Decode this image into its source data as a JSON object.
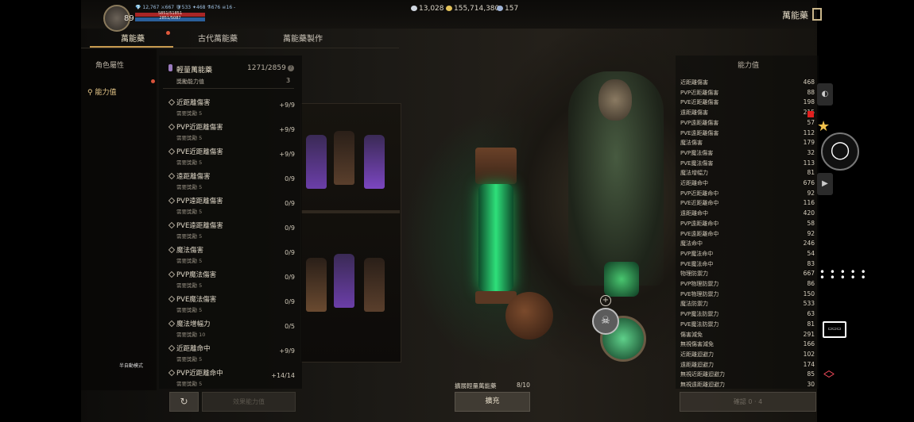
{
  "topbar": {
    "level": "89",
    "stats": "💎 12,767  ⚔667  🛡533  ✦468  ⚗676  ☠16 -",
    "hp_text": "5851/51851",
    "mp_text": "2851/5087",
    "currencies": [
      {
        "name": "diamond",
        "value": "13,028",
        "color": "#cfd6e0"
      },
      {
        "name": "gold",
        "value": "155,714,380",
        "color": "#e3c25a"
      },
      {
        "name": "carriage",
        "value": "157",
        "color": "#9fb4d6"
      }
    ],
    "page_title": "萬能藥"
  },
  "tabs": [
    {
      "label": "萬能藥",
      "active": true
    },
    {
      "label": "古代萬能藥",
      "active": false
    },
    {
      "label": "萬能藥製作",
      "active": false
    }
  ],
  "left_nav": {
    "items": [
      {
        "label": "角色屬性",
        "active": false
      },
      {
        "label": "能力值",
        "active": true
      }
    ],
    "auto_mode": "半自動模式"
  },
  "potion": {
    "name": "輕量萬能藥",
    "count": "1271/2859",
    "reward_label": "獎勵能力值",
    "reward_value": "3"
  },
  "upgrade_rows": [
    {
      "name": "近距離傷害",
      "req": "需要獎勵 5",
      "value": "+9/9"
    },
    {
      "name": "PVP近距離傷害",
      "req": "需要獎勵 5",
      "value": "+9/9"
    },
    {
      "name": "PVE近距離傷害",
      "req": "需要獎勵 5",
      "value": "+9/9"
    },
    {
      "name": "遠距離傷害",
      "req": "需要獎勵 5",
      "value": "0/9"
    },
    {
      "name": "PVP遠距離傷害",
      "req": "需要獎勵 5",
      "value": "0/9"
    },
    {
      "name": "PVE遠距離傷害",
      "req": "需要獎勵 5",
      "value": "0/9"
    },
    {
      "name": "魔法傷害",
      "req": "需要獎勵 5",
      "value": "0/9"
    },
    {
      "name": "PVP魔法傷害",
      "req": "需要獎勵 5",
      "value": "0/9"
    },
    {
      "name": "PVE魔法傷害",
      "req": "需要獎勵 5",
      "value": "0/9"
    },
    {
      "name": "魔法增幅力",
      "req": "需要獎勵 10",
      "value": "0/5"
    },
    {
      "name": "近距離命中",
      "req": "需要獎勵 5",
      "value": "+9/9"
    },
    {
      "name": "PVP近距離命中",
      "req": "需要獎勵 5",
      "value": "+14/14"
    }
  ],
  "buttons": {
    "refresh": "↻",
    "apply": "效果能力值",
    "expand_label": "擴展輕量萬能藥",
    "expand_count": "8/10",
    "expand": "擴充",
    "confirm": "確認 0 · 4"
  },
  "stats_panel": {
    "title": "能力值",
    "rows": [
      {
        "k": "近距離傷害",
        "v": "468"
      },
      {
        "k": "PVP近距離傷害",
        "v": "88"
      },
      {
        "k": "PVE近距離傷害",
        "v": "198"
      },
      {
        "k": "遠距離傷害",
        "v": "215"
      },
      {
        "k": "PVP遠距離傷害",
        "v": "57"
      },
      {
        "k": "PVE遠距離傷害",
        "v": "112"
      },
      {
        "k": "魔法傷害",
        "v": "179"
      },
      {
        "k": "PVP魔法傷害",
        "v": "32"
      },
      {
        "k": "PVE魔法傷害",
        "v": "113"
      },
      {
        "k": "魔法增幅力",
        "v": "81"
      },
      {
        "k": "近距離命中",
        "v": "676"
      },
      {
        "k": "PVP近距離命中",
        "v": "92"
      },
      {
        "k": "PVE近距離命中",
        "v": "116"
      },
      {
        "k": "遠距離命中",
        "v": "420"
      },
      {
        "k": "PVP遠距離命中",
        "v": "58"
      },
      {
        "k": "PVE遠距離命中",
        "v": "92"
      },
      {
        "k": "魔法命中",
        "v": "246"
      },
      {
        "k": "PVP魔法命中",
        "v": "54"
      },
      {
        "k": "PVE魔法命中",
        "v": "83"
      },
      {
        "k": "物理防禦力",
        "v": "667"
      },
      {
        "k": "PVP物理防禦力",
        "v": "86"
      },
      {
        "k": "PVE物理防禦力",
        "v": "150"
      },
      {
        "k": "魔法防禦力",
        "v": "533"
      },
      {
        "k": "PVP魔法防禦力",
        "v": "63"
      },
      {
        "k": "PVE魔法防禦力",
        "v": "81"
      },
      {
        "k": "傷害減免",
        "v": "291"
      },
      {
        "k": "無視傷害減免",
        "v": "166"
      },
      {
        "k": "近距離迴避力",
        "v": "102"
      },
      {
        "k": "遠距離迴避力",
        "v": "174"
      },
      {
        "k": "無視近距離迴避力",
        "v": "85"
      },
      {
        "k": "無視遠距離迴避力",
        "v": "30"
      }
    ]
  },
  "overlay": {
    "circle_icon": "◯",
    "zoom_plus": "+"
  }
}
